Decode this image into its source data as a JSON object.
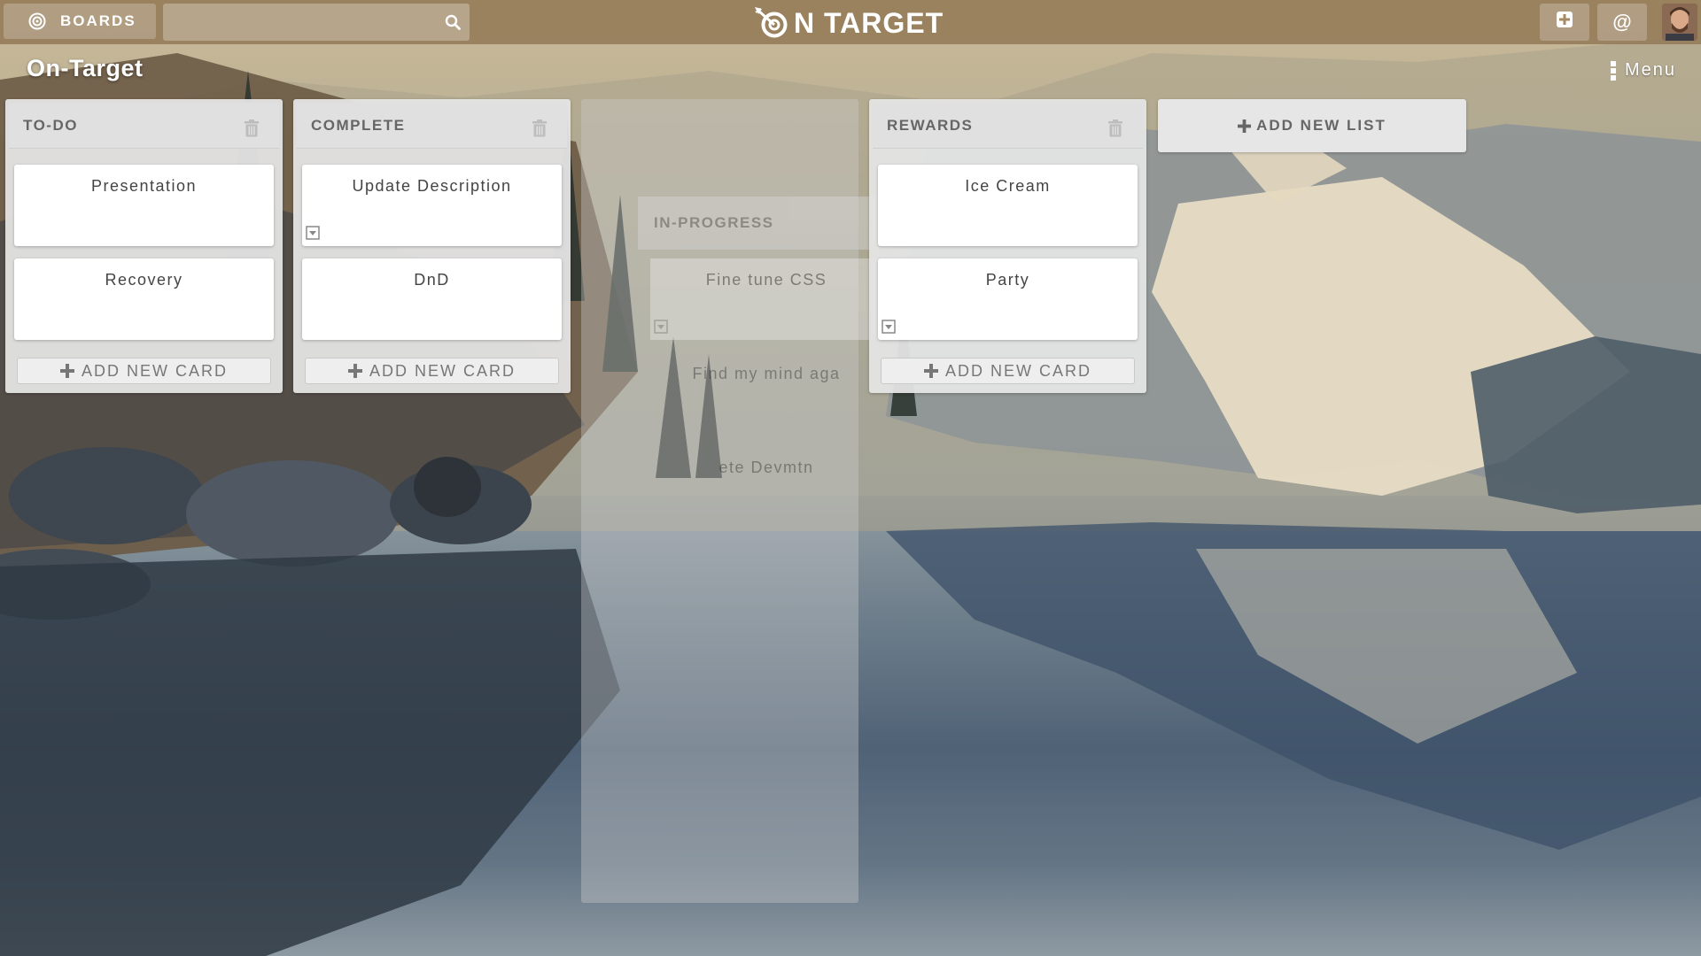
{
  "topbar": {
    "boards_label": "BOARDS",
    "search_placeholder": "",
    "brand": "N TARGET",
    "add_icon": "plus-square-icon",
    "mention_label": "@"
  },
  "board": {
    "title": "On-Target",
    "menu_label": "Menu"
  },
  "lists": [
    {
      "title": "TO-DO",
      "cards": [
        "Presentation",
        "Recovery"
      ],
      "add_card_label": "ADD NEW CARD"
    },
    {
      "title": "COMPLETE",
      "cards": [
        "Update Description",
        "DnD"
      ],
      "add_card_label": "ADD NEW CARD"
    },
    {
      "title": "REWARDS",
      "cards": [
        "Ice Cream",
        "Party"
      ],
      "add_card_label": "ADD NEW CARD"
    }
  ],
  "dragging_list": {
    "title": "IN-PROGRESS",
    "cards": [
      "Fine tune CSS",
      "Find my mind aga",
      "ete Devmtn"
    ]
  },
  "add_list_label": "ADD NEW LIST",
  "colors": {
    "topbar": "#967d5a",
    "list_bg": "#e4e4e4",
    "card_bg": "#ffffff"
  }
}
